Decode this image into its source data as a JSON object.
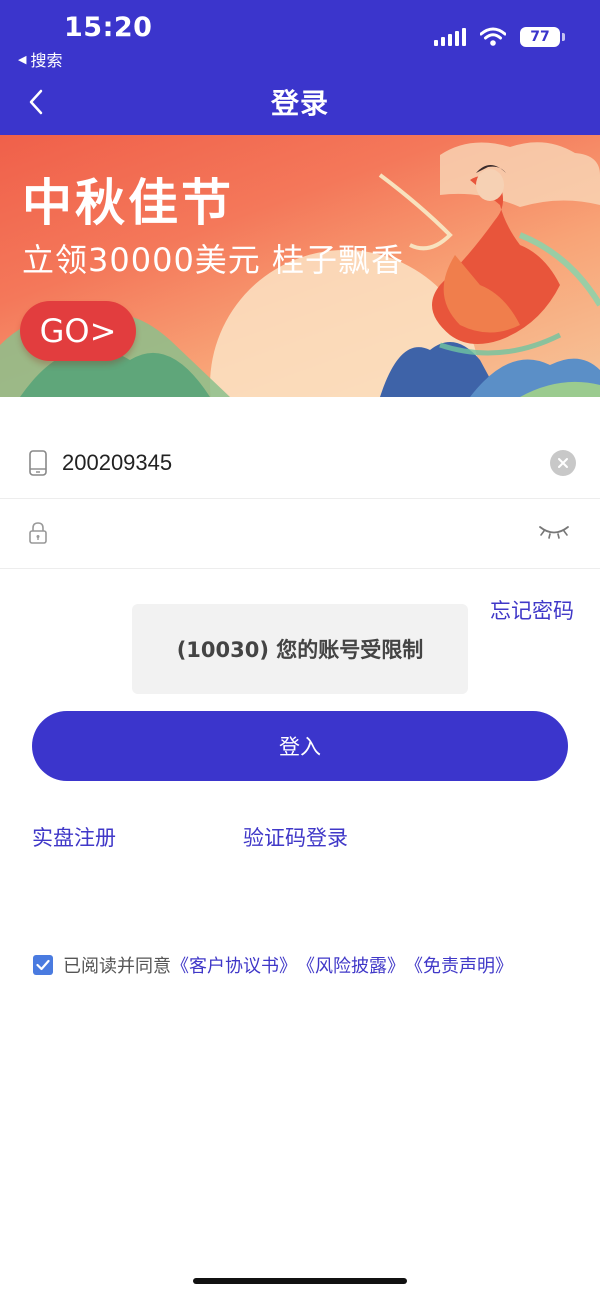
{
  "status_bar": {
    "time": "15:20",
    "back_app": "搜索",
    "battery": "77"
  },
  "nav": {
    "title": "登录",
    "back_icon": "chevron-left-icon"
  },
  "banner": {
    "title": "中秋佳节",
    "subtitle": "立领30000美元 桂子飘香",
    "cta": "GO>"
  },
  "form": {
    "account_value": "200209345",
    "password_value": "",
    "phone_icon": "phone-icon",
    "lock_icon": "lock-icon",
    "eye_icon": "eye-closed-icon",
    "clear_icon": "clear-icon"
  },
  "forgot_password": "忘记密码",
  "toast": "(10030) 您的账号受限制",
  "login_button": "登入",
  "links": {
    "register": "实盘注册",
    "sms_login": "验证码登录"
  },
  "agreement": {
    "checked": true,
    "prefix": "已阅读并同意",
    "items": [
      "《客户协议书》",
      "《风险披露》",
      "《免责声明》"
    ]
  },
  "colors": {
    "primary": "#3B35CC",
    "link": "#4038C8",
    "go_button": "#E23D3E",
    "checkbox": "#4A7BE0"
  }
}
